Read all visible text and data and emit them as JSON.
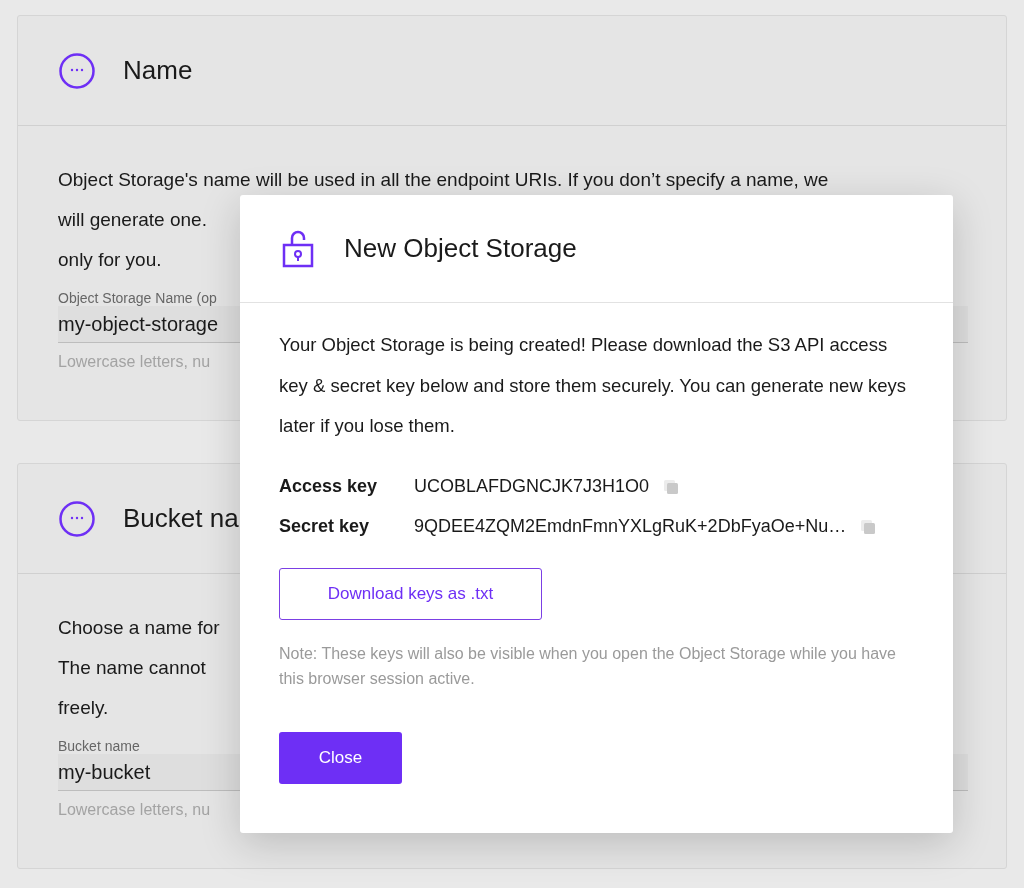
{
  "cards": [
    {
      "title": "Name",
      "description_lines": [
        "Object Storage's name will be used in all the endpoint URIs. If you don’t specify a name, we",
        "will generate one.",
        "only for you."
      ],
      "field": {
        "label": "Object Storage Name (op",
        "value": "my-object-storage",
        "hint": "Lowercase letters, nu"
      }
    },
    {
      "title": "Bucket na",
      "description_lines": [
        "Choose a name for",
        "The name cannot",
        "freely."
      ],
      "field": {
        "label": "Bucket name",
        "value": "my-bucket",
        "hint": "Lowercase letters, nu"
      }
    }
  ],
  "dialog": {
    "title": "New Object Storage",
    "message": "Your Object Storage is being created! Please download the S3 API access key & secret key below and store them securely. You can generate new keys later if you lose them.",
    "keys": [
      {
        "label": "Access key",
        "value": "UCOBLAFDGNCJK7J3H1O0"
      },
      {
        "label": "Secret key",
        "value": "9QDEE4ZQM2EmdnFmnYXLgRuK+2DbFyaOe+Nu…"
      }
    ],
    "download_button": "Download keys as .txt",
    "note": "Note: These keys will also be visible when you open the Object Storage while you have this browser session active.",
    "close_button": "Close"
  }
}
